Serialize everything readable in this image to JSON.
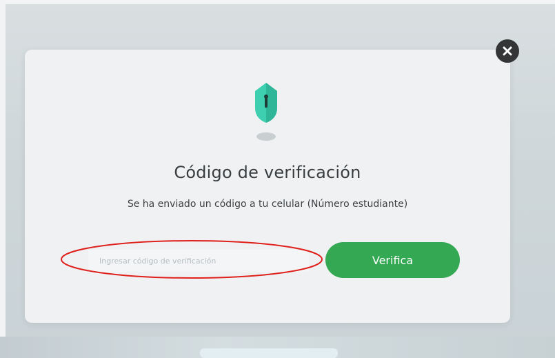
{
  "dialog": {
    "title": "Código de verificación",
    "subtitle": "Se ha enviado un código a tu celular (Número estudiante)",
    "input_placeholder": "Ingresar código de verificación",
    "input_value": "",
    "verify_label": "Verifica",
    "close_icon": "close-icon",
    "illustration_icon": "shield-icon"
  },
  "colors": {
    "accent": "#34a853",
    "shield": "#3ecfb0",
    "close_bg": "#333536",
    "annotation": "#e0201b"
  }
}
